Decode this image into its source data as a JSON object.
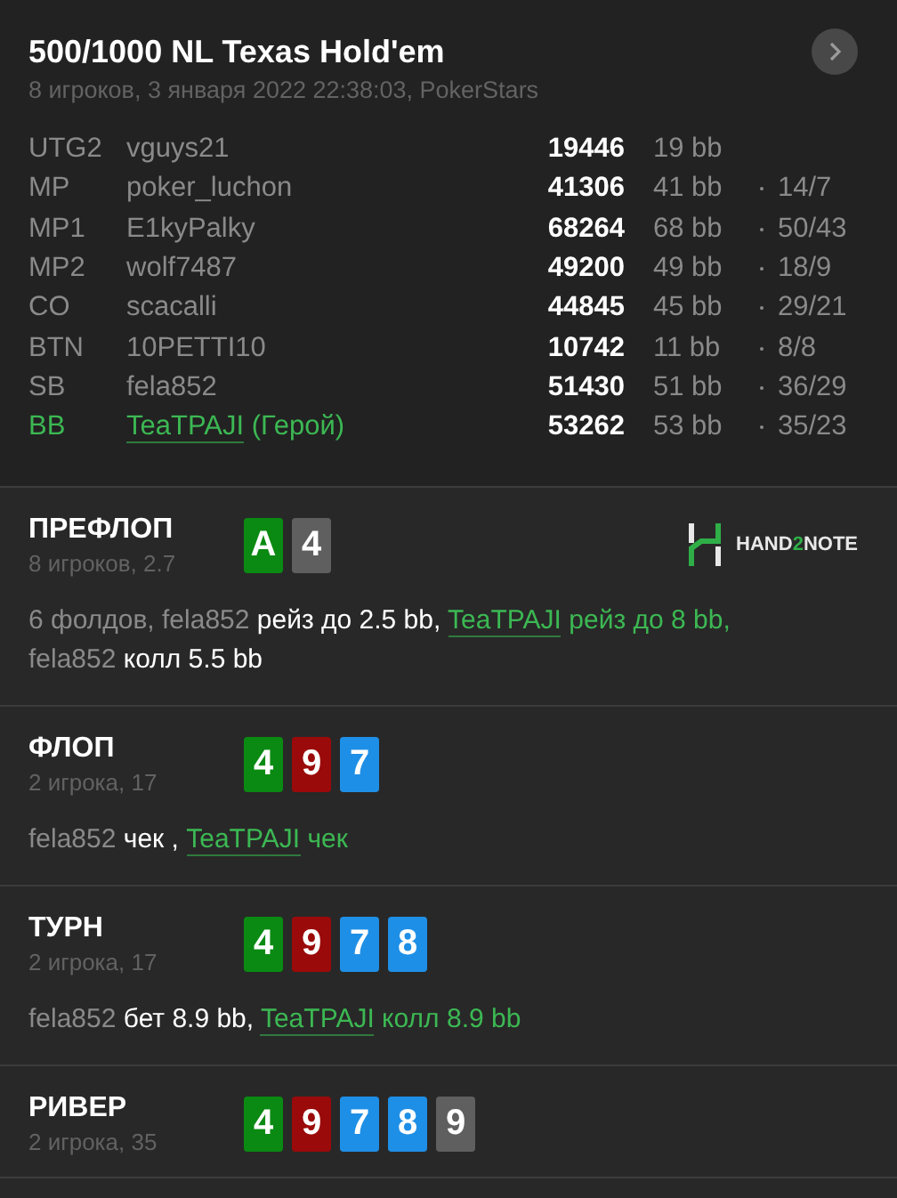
{
  "hand": {
    "title": "500/1000 NL Texas Hold'em",
    "subtitle": "8 игроков, 3 января 2022 22:38:03, PokerStars"
  },
  "players": [
    {
      "position": "UTG2",
      "name": "vguys21",
      "stack": "19446",
      "bb": "19 bb",
      "hero": false
    },
    {
      "position": "MP",
      "name": "poker_luchon",
      "stack": "41306",
      "bb": "41 bb",
      "stats": "14/7",
      "hero": false
    },
    {
      "position": "MP1",
      "name": "E1kyPalky",
      "stack": "68264",
      "bb": "68 bb",
      "stats": "50/43",
      "hero": false
    },
    {
      "position": "MP2",
      "name": "wolf7487",
      "stack": "49200",
      "bb": "49 bb",
      "stats": "18/9",
      "hero": false
    },
    {
      "position": "CO",
      "name": "scacalli",
      "stack": "44845",
      "bb": "45 bb",
      "stats": "29/21",
      "hero": false
    },
    {
      "position": "BTN",
      "name": "10PETTI10",
      "stack": "10742",
      "bb": "11 bb",
      "stats": "8/8",
      "hero": false
    },
    {
      "position": "SB",
      "name": "fela852",
      "stack": "51430",
      "bb": "51 bb",
      "stats": "36/29",
      "hero": false
    },
    {
      "position": "BB",
      "name": "TeaTPAJI",
      "hero_label": "(Герой)",
      "stack": "53262",
      "bb": "53 bb",
      "stats": "35/23",
      "hero": true
    }
  ],
  "streets": [
    {
      "name": "ПРЕФЛОП",
      "info": "8 игроков, 2.7",
      "logo": {
        "before": "HAND",
        "accent": "2",
        "after": "NOTE"
      },
      "cards": [
        {
          "rank": "A",
          "color": "#0a8a12"
        },
        {
          "rank": "4",
          "color": "#5f5f5f"
        }
      ],
      "actions": [
        {
          "kind": "player",
          "text": "6 фолдов, fela852 "
        },
        {
          "kind": "action",
          "text": "рейз до 2.5 bb, "
        },
        {
          "kind": "hero",
          "text": "TeaTPAJI"
        },
        {
          "kind": "hero_action",
          "text": " рейз до 8 bb, "
        },
        {
          "kind": "player",
          "text": "fela852 "
        },
        {
          "kind": "action",
          "text": "колл 5.5 bb"
        }
      ]
    },
    {
      "name": "ФЛОП",
      "info": "2 игрока, 17",
      "cards": [
        {
          "rank": "4",
          "color": "#0a8a12"
        },
        {
          "rank": "9",
          "color": "#9b0a0a"
        },
        {
          "rank": "7",
          "color": "#1e8fe6"
        }
      ],
      "actions": [
        {
          "kind": "player",
          "text": "fela852 "
        },
        {
          "kind": "action",
          "text": "чек , "
        },
        {
          "kind": "hero",
          "text": "TeaTPAJI"
        },
        {
          "kind": "hero_action",
          "text": " чек"
        }
      ]
    },
    {
      "name": "ТУРН",
      "info": "2 игрока, 17",
      "cards": [
        {
          "rank": "4",
          "color": "#0a8a12"
        },
        {
          "rank": "9",
          "color": "#9b0a0a"
        },
        {
          "rank": "7",
          "color": "#1e8fe6"
        },
        {
          "rank": "8",
          "color": "#1e8fe6"
        }
      ],
      "actions": [
        {
          "kind": "player",
          "text": "fela852 "
        },
        {
          "kind": "action",
          "text": "бет 8.9 bb, "
        },
        {
          "kind": "hero",
          "text": "TeaTPAJI"
        },
        {
          "kind": "hero_action",
          "text": " колл 8.9 bb"
        }
      ]
    },
    {
      "name": "РИВЕР",
      "info": "2 игрока, 35",
      "cards": [
        {
          "rank": "4",
          "color": "#0a8a12"
        },
        {
          "rank": "9",
          "color": "#9b0a0a"
        },
        {
          "rank": "7",
          "color": "#1e8fe6"
        },
        {
          "rank": "8",
          "color": "#1e8fe6"
        },
        {
          "rank": "9",
          "color": "#5f5f5f"
        }
      ]
    }
  ]
}
